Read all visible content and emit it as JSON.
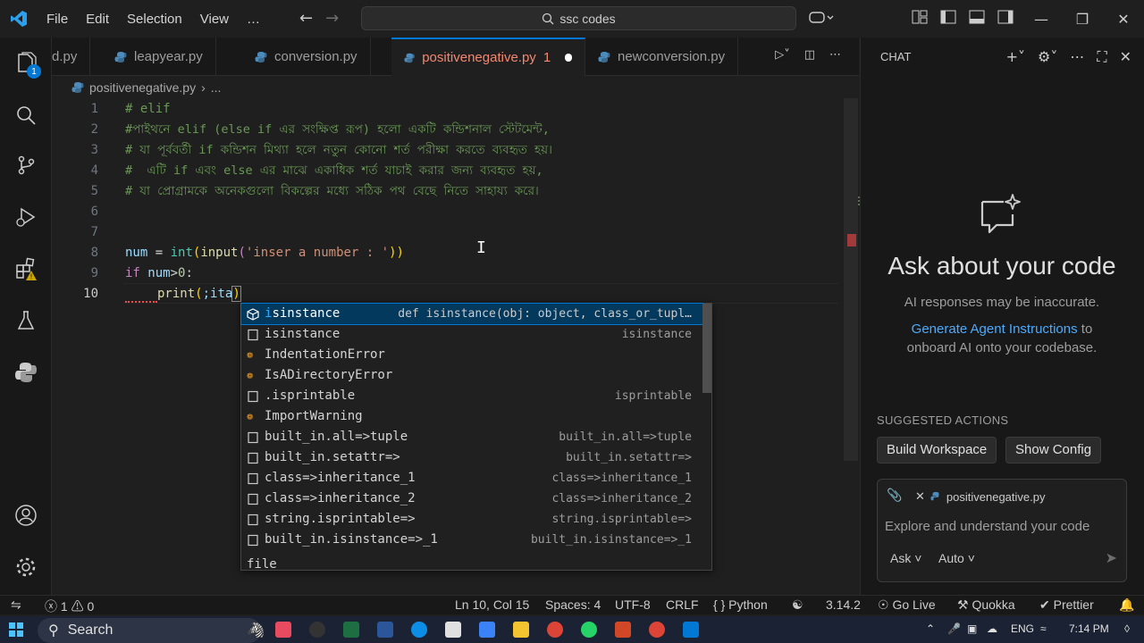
{
  "menu": [
    "File",
    "Edit",
    "Selection",
    "View",
    "…"
  ],
  "command_center": "ssc codes",
  "activity": {
    "explorer_badge": "1"
  },
  "tabs": [
    {
      "label": "d.py",
      "active": false
    },
    {
      "label": "leapyear.py",
      "active": false
    },
    {
      "label": "conversion.py",
      "active": false
    },
    {
      "label": "positivenegative.py",
      "badge": "1",
      "active": true
    },
    {
      "label": "newconversion.py",
      "active": false
    }
  ],
  "breadcrumb": {
    "file": "positivenegative.py",
    "more": "..."
  },
  "editor": {
    "lines": [
      {
        "n": "1",
        "text": "# elif"
      },
      {
        "n": "2",
        "text": "#পাইথনে elif (else if এর সংক্ষিপ্ত রূপ) হলো একটি কন্ডিশনাল স্টেটমেন্ট,"
      },
      {
        "n": "3",
        "text": "# যা পূর্ববর্তী if কন্ডিশন মিথ্যা হলে নতুন কোনো শর্ত পরীক্ষা করতে ব্যবহৃত হয়।"
      },
      {
        "n": "4",
        "text": "#  এটি if এবং else এর মাঝে একাধিক শর্ত যাচাই করার জন্য ব্যবহৃত হয়,"
      },
      {
        "n": "5",
        "text": "# যা প্রোগ্রামকে অনেকগুলো বিকল্পের মধ্যে সঠিক পথ বেছে নিতে সাহায্য করে।"
      },
      {
        "n": "6",
        "text": ""
      },
      {
        "n": "7",
        "text": ""
      },
      {
        "n": "8",
        "text": "num = int(input('inser a number : '))"
      },
      {
        "n": "9",
        "text": "if num>0:"
      },
      {
        "n": "10",
        "text": "    print(;ita)"
      }
    ],
    "code8": {
      "a": "num",
      "b": " = ",
      "c": "int",
      "d": "(",
      "e": "input",
      "f": "(",
      "g": "'inser a number : '",
      "h": "))"
    },
    "code9": {
      "a": "if",
      "b": " num",
      "c": ">",
      "d": "0",
      "e": ":"
    },
    "code10": {
      "a": "print",
      "b": "(",
      "c": ";ita",
      "d": ")"
    }
  },
  "suggest": {
    "items": [
      {
        "pre": "i",
        "label": "isinstance",
        "detail": "def isinstance(obj: object, class_or_tupl…",
        "icon": "cube"
      },
      {
        "label": "isinstance",
        "detail": "isinstance",
        "icon": "snippet"
      },
      {
        "label": "IndentationError",
        "detail": "",
        "icon": "class"
      },
      {
        "label": "IsADirectoryError",
        "detail": "",
        "icon": "class"
      },
      {
        "label": ".isprintable",
        "detail": "isprintable",
        "icon": "snippet"
      },
      {
        "label": "ImportWarning",
        "detail": "",
        "icon": "class"
      },
      {
        "label": "built_in.all=>tuple",
        "detail": "built_in.all=>tuple",
        "icon": "snippet"
      },
      {
        "label": "built_in.setattr=>",
        "detail": "built_in.setattr=>",
        "icon": "snippet"
      },
      {
        "label": "class=>inheritance_1",
        "detail": "class=>inheritance_1",
        "icon": "snippet"
      },
      {
        "label": "class=>inheritance_2",
        "detail": "class=>inheritance_2",
        "icon": "snippet"
      },
      {
        "label": "string.isprintable=>",
        "detail": "string.isprintable=>",
        "icon": "snippet"
      },
      {
        "label": "built_in.isinstance=>_1",
        "detail": "built_in.isinstance=>_1",
        "icon": "snippet"
      }
    ],
    "extra": "file"
  },
  "chat": {
    "header": "CHAT",
    "title": "Ask about your code",
    "subtitle": "AI responses may be inaccurate.",
    "link": "Generate Agent Instructions",
    "link_rest": " to onboard AI onto your codebase.",
    "suggested_header": "SUGGESTED ACTIONS",
    "actions": [
      "Build Workspace",
      "Show Config"
    ],
    "context_file": "positivenegative.py",
    "placeholder": "Explore and understand your code",
    "mode": "Ask",
    "model": "Auto"
  },
  "status": {
    "errors": "1",
    "warnings": "0",
    "position": "Ln 10, Col 15",
    "spaces": "Spaces: 4",
    "encoding": "UTF-8",
    "eol": "CRLF",
    "language": "Python",
    "version": "3.14.2",
    "golive": "Go Live",
    "quokka": "Quokka",
    "prettier": "Prettier"
  },
  "taskbar": {
    "search": "Search",
    "lang": "ENG",
    "time": "7:14 PM"
  },
  "colors": {
    "accent": "#0078d4",
    "comment": "#6a9955",
    "keyword": "#c586c0",
    "function": "#dcdcaa",
    "string": "#ce9178",
    "modified_tab": "#e2c08d"
  }
}
